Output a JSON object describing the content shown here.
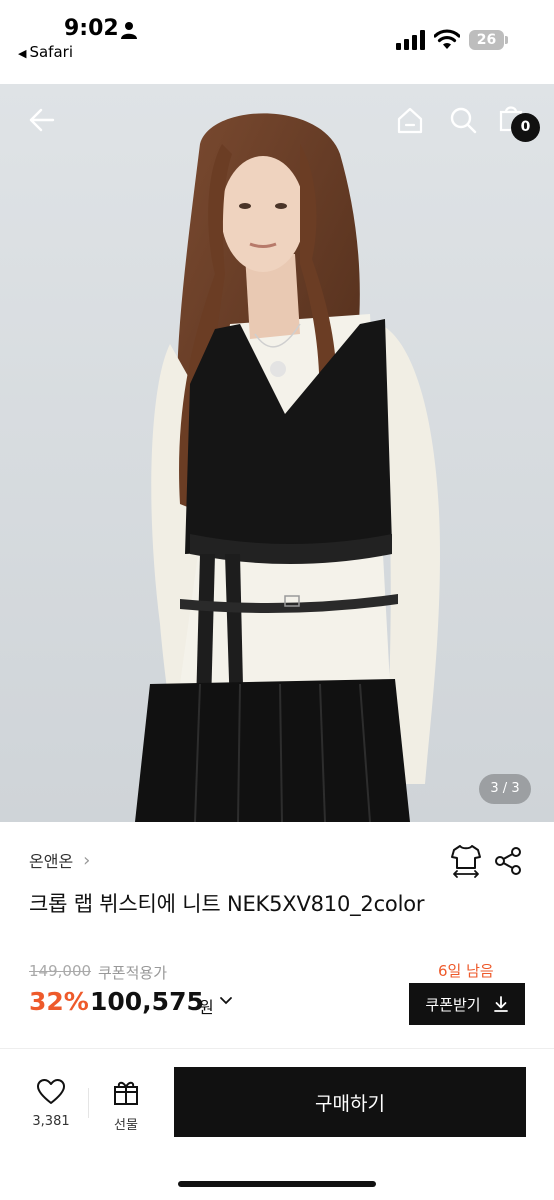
{
  "status_bar": {
    "time": "9:02",
    "back_app": "Safari",
    "battery": "26"
  },
  "header": {
    "back_icon": "arrow-left-icon",
    "home_icon": "home-icon",
    "search_icon": "search-icon",
    "cart_icon": "shopping-bag-icon",
    "cart_count": "0"
  },
  "gallery": {
    "pager": "3 / 3"
  },
  "product": {
    "brand": "온앤온",
    "brand_chevron": "›",
    "size_icon": "tshirt-size-icon",
    "share_icon": "share-icon",
    "title": "크롭 랩 뷔스티에 니트 NEK5XV810_2color",
    "original_price": "149,000",
    "coupon_note": "쿠폰적용가",
    "discount": "32%",
    "price": "100,575",
    "currency": "원",
    "days_left": "6일 남음",
    "coupon_button": "쿠폰받기"
  },
  "bottom_bar": {
    "like_count": "3,381",
    "gift_label": "선물",
    "buy_button": "구매하기"
  },
  "colors": {
    "accent": "#ee5a2b",
    "primary": "#111111"
  }
}
